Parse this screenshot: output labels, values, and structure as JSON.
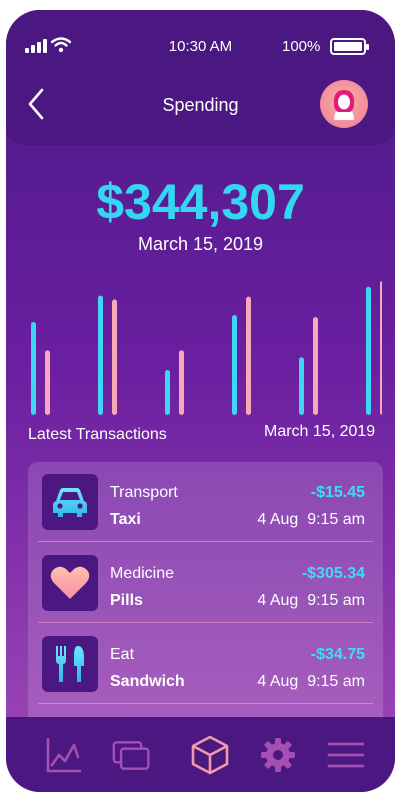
{
  "status_bar": {
    "time": "10:30 AM",
    "battery": "100%",
    "battery_level": 1.0
  },
  "header": {
    "title": "Spending"
  },
  "summary": {
    "total": "$344,307",
    "date": "March 15, 2019"
  },
  "chart": {
    "label_left": "Latest Transactions",
    "label_right": "March 15, 2019"
  },
  "chart_data": {
    "type": "bar",
    "categories": [
      "1",
      "2",
      "3",
      "4",
      "5",
      "6"
    ],
    "series": [
      {
        "values": [
          95,
          122,
          46,
          102,
          59,
          131
        ]
      },
      {
        "values": [
          66,
          118,
          66,
          121,
          100,
          137
        ]
      }
    ],
    "ylim": [
      0,
      140
    ],
    "title": "",
    "xlabel": "",
    "ylabel": "",
    "colors": [
      "#3fd6f4",
      "#f7a9b8"
    ]
  },
  "transactions": [
    {
      "category": "Transport",
      "name": "Taxi",
      "amount": "-$15.45",
      "date": "4 Aug",
      "time": "9:15 am",
      "icon": "car-icon"
    },
    {
      "category": "Medicine",
      "name": "Pills",
      "amount": "-$305.34",
      "date": "4 Aug",
      "time": "9:15 am",
      "icon": "heart-icon"
    },
    {
      "category": "Eat",
      "name": "Sandwich",
      "amount": "-$34.75",
      "date": "4 Aug",
      "time": "9:15 am",
      "icon": "fork-knife-icon"
    }
  ],
  "nav": [
    {
      "icon": "chart-icon",
      "active": false
    },
    {
      "icon": "cards-icon",
      "active": false
    },
    {
      "icon": "cube-icon",
      "active": true
    },
    {
      "icon": "gear-icon",
      "active": false
    },
    {
      "icon": "menu-icon",
      "active": false
    }
  ],
  "colors": {
    "accent": "#35d6f2",
    "bar_alt": "#f7a9b8",
    "header": "#4b1882",
    "nav_icon": "#a64fb2",
    "nav_active": "#f19aa8"
  }
}
